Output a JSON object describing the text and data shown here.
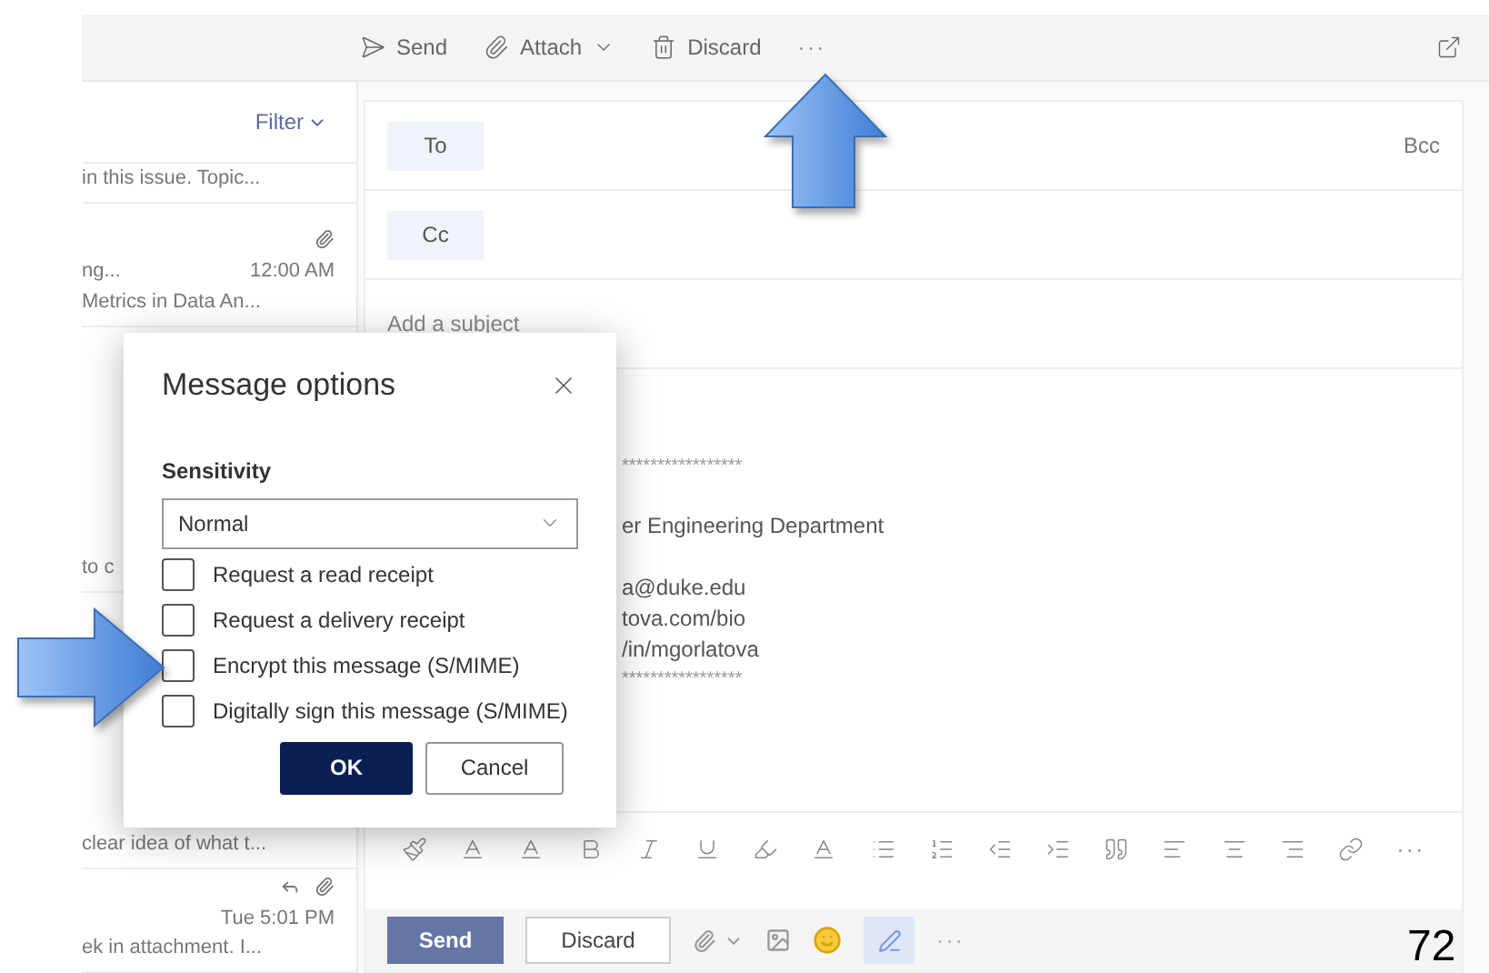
{
  "toolbar": {
    "actions": [
      {
        "kind": "send",
        "label": "Send"
      },
      {
        "kind": "attach",
        "label": "Attach"
      },
      {
        "kind": "discard",
        "label": "Discard"
      },
      {
        "kind": "more",
        "label": "···"
      }
    ]
  },
  "message_list": {
    "filter": "Filter",
    "items": [
      {
        "lines": [
          "in this issue. Topic..."
        ]
      },
      {
        "attachment": true,
        "time": "12:00 AM",
        "lines": [
          "ng...",
          "Metrics in Data An..."
        ]
      },
      {
        "lines": [
          "to c"
        ]
      },
      {
        "lines": [
          "clear idea of what t..."
        ]
      },
      {
        "attachment": true,
        "time": "Tue 5:01 PM",
        "lines": [
          "ek in attachment. I..."
        ]
      }
    ]
  },
  "compose": {
    "to": "To",
    "cc": "Cc",
    "bcc": "Bcc",
    "subject_placeholder": "Add a subject",
    "body": [
      {
        "kind": "rule",
        "text": "*****************"
      },
      {
        "kind": "text",
        "gap": true,
        "text": "er Engineering Department"
      },
      {
        "kind": "text",
        "gap": true,
        "text": "a@duke.edu"
      },
      {
        "kind": "text",
        "text": "tova.com/bio"
      },
      {
        "kind": "text",
        "text": "/in/mgorlatova"
      },
      {
        "kind": "rule",
        "text": "*****************"
      }
    ],
    "send": "Send",
    "discard": "Discard",
    "more": "···"
  },
  "dialog": {
    "title": "Message options",
    "sensitivity_label": "Sensitivity",
    "sensitivity": "Normal",
    "options": [
      {
        "label": "Request a read receipt",
        "checked": false
      },
      {
        "label": "Request a delivery receipt",
        "checked": false
      },
      {
        "label": "Encrypt this message (S/MIME)",
        "checked": false
      },
      {
        "label": "Digitally sign this message (S/MIME)",
        "checked": false
      }
    ],
    "ok": "OK",
    "cancel": "Cancel"
  },
  "slide_number": "72"
}
